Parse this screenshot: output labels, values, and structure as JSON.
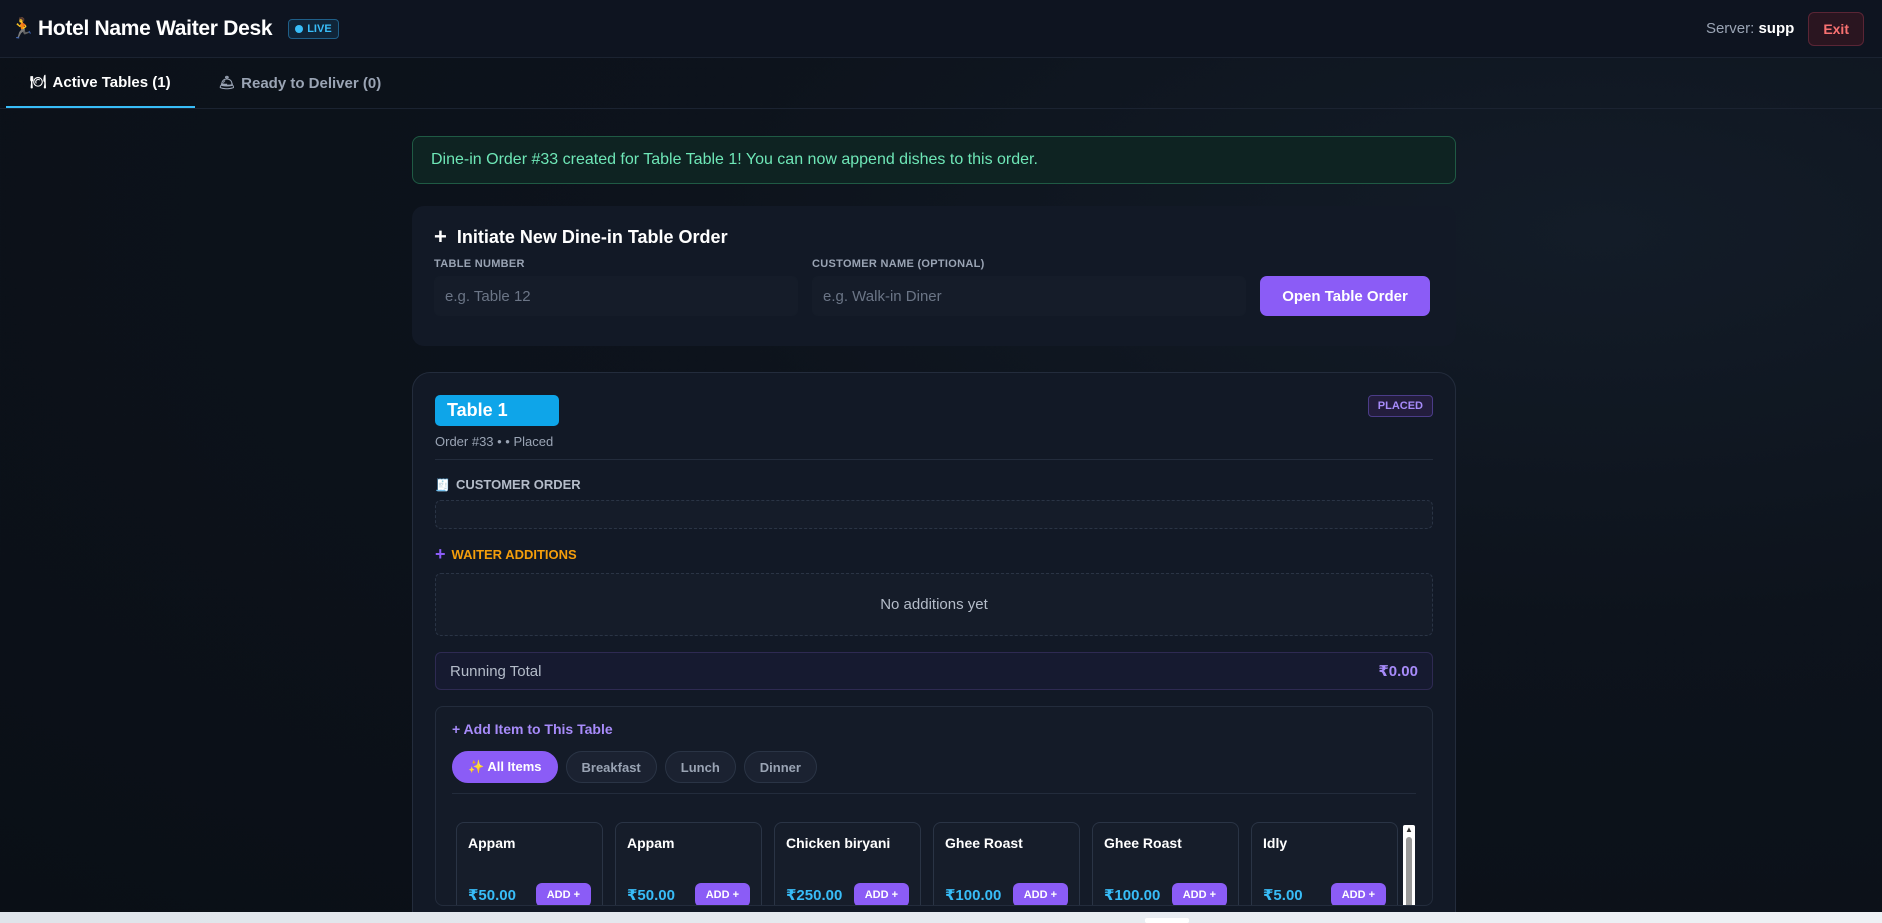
{
  "header": {
    "title": "Hotel Name Waiter Desk",
    "live_label": "LIVE",
    "server_label": "Server:",
    "server_name": "supp",
    "exit_label": "Exit"
  },
  "tabs": [
    {
      "label": "Active Tables (1)",
      "icon": "plate-icon",
      "active": true
    },
    {
      "label": "Ready to Deliver (0)",
      "icon": "cloche-icon",
      "active": false
    }
  ],
  "alert": {
    "message": "Dine-in Order #33 created for Table Table 1! You can now append dishes to this order."
  },
  "new_order": {
    "title": "Initiate New Dine-in Table Order",
    "table_label": "TABLE NUMBER",
    "table_placeholder": "e.g. Table 12",
    "customer_label": "CUSTOMER NAME (OPTIONAL)",
    "customer_placeholder": "e.g. Walk-in Diner",
    "button_label": "Open Table Order"
  },
  "table": {
    "name": "Table 1",
    "meta": "Order #33 • • Placed",
    "status": "PLACED",
    "customer_order_label": "CUSTOMER ORDER",
    "waiter_additions_label": "WAITER ADDITIONS",
    "no_additions": "No additions yet",
    "running_total_label": "Running Total",
    "running_total_value": "₹0.00"
  },
  "add_items": {
    "title": "+ Add Item to This Table",
    "categories": [
      {
        "label": "✨ All Items",
        "active": true
      },
      {
        "label": "Breakfast",
        "active": false
      },
      {
        "label": "Lunch",
        "active": false
      },
      {
        "label": "Dinner",
        "active": false
      }
    ],
    "add_label": "ADD +",
    "items": [
      {
        "name": "Appam",
        "price": "₹50.00"
      },
      {
        "name": "Appam",
        "price": "₹50.00"
      },
      {
        "name": "Chicken biryani",
        "price": "₹250.00"
      },
      {
        "name": "Ghee Roast",
        "price": "₹100.00"
      },
      {
        "name": "Ghee Roast",
        "price": "₹100.00"
      },
      {
        "name": "Idly",
        "price": "₹5.00"
      }
    ]
  },
  "colors": {
    "accent": "#8b5cf6",
    "live": "#38bdf8",
    "success": "#6ee7b7",
    "warning": "#f59e0b",
    "danger": "#f87171"
  }
}
